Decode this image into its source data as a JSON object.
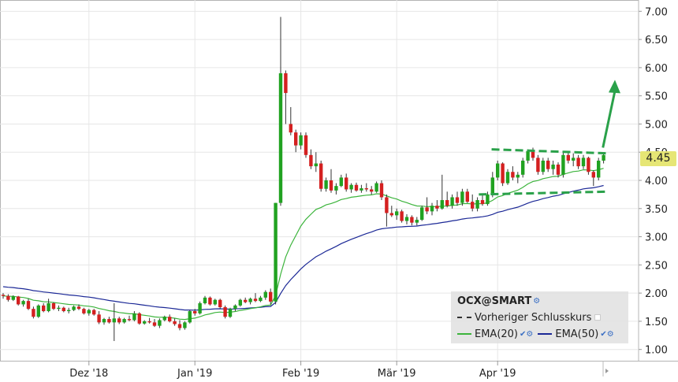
{
  "chart_data": {
    "type": "candlestick",
    "y_ticks": [
      "7.00",
      "6.50",
      "6.00",
      "5.50",
      "5.00",
      "4.50",
      "4.00",
      "3.50",
      "3.00",
      "2.50",
      "2.00",
      "1.50",
      "1.00"
    ],
    "ylim": [
      0.8,
      7.2
    ],
    "x_ticks": [
      "Dez '18",
      "Jan '19",
      "Feb '19",
      "Mär '19",
      "Apr '19"
    ],
    "x_tick_index": [
      17,
      38,
      59,
      78,
      98
    ],
    "current_price": "4.45",
    "candles": [
      [
        1.97,
        2.0,
        1.9,
        1.95
      ],
      [
        1.95,
        1.98,
        1.85,
        1.88
      ],
      [
        1.88,
        1.96,
        1.86,
        1.94
      ],
      [
        1.94,
        1.95,
        1.78,
        1.8
      ],
      [
        1.8,
        1.88,
        1.76,
        1.86
      ],
      [
        1.86,
        1.9,
        1.7,
        1.72
      ],
      [
        1.72,
        1.76,
        1.55,
        1.58
      ],
      [
        1.58,
        1.8,
        1.56,
        1.78
      ],
      [
        1.78,
        1.82,
        1.66,
        1.68
      ],
      [
        1.68,
        1.9,
        1.66,
        1.82
      ],
      [
        1.82,
        1.84,
        1.7,
        1.72
      ],
      [
        1.72,
        1.78,
        1.68,
        1.74
      ],
      [
        1.74,
        1.76,
        1.66,
        1.68
      ],
      [
        1.68,
        1.74,
        1.64,
        1.7
      ],
      [
        1.7,
        1.78,
        1.68,
        1.76
      ],
      [
        1.76,
        1.8,
        1.7,
        1.72
      ],
      [
        1.72,
        1.74,
        1.62,
        1.64
      ],
      [
        1.64,
        1.72,
        1.6,
        1.7
      ],
      [
        1.7,
        1.72,
        1.6,
        1.62
      ],
      [
        1.62,
        1.68,
        1.45,
        1.48
      ],
      [
        1.48,
        1.56,
        1.44,
        1.54
      ],
      [
        1.54,
        1.58,
        1.46,
        1.48
      ],
      [
        1.48,
        1.82,
        1.15,
        1.55
      ],
      [
        1.55,
        1.58,
        1.45,
        1.48
      ],
      [
        1.48,
        1.56,
        1.46,
        1.54
      ],
      [
        1.54,
        1.6,
        1.5,
        1.52
      ],
      [
        1.52,
        1.68,
        1.5,
        1.64
      ],
      [
        1.64,
        1.66,
        1.44,
        1.46
      ],
      [
        1.46,
        1.52,
        1.44,
        1.5
      ],
      [
        1.5,
        1.56,
        1.46,
        1.48
      ],
      [
        1.48,
        1.54,
        1.4,
        1.42
      ],
      [
        1.42,
        1.55,
        1.38,
        1.52
      ],
      [
        1.52,
        1.6,
        1.5,
        1.58
      ],
      [
        1.58,
        1.62,
        1.48,
        1.5
      ],
      [
        1.5,
        1.55,
        1.42,
        1.45
      ],
      [
        1.45,
        1.52,
        1.34,
        1.38
      ],
      [
        1.38,
        1.5,
        1.35,
        1.48
      ],
      [
        1.48,
        1.7,
        1.46,
        1.68
      ],
      [
        1.68,
        1.72,
        1.6,
        1.64
      ],
      [
        1.64,
        1.85,
        1.62,
        1.82
      ],
      [
        1.82,
        1.95,
        1.8,
        1.92
      ],
      [
        1.92,
        1.94,
        1.78,
        1.8
      ],
      [
        1.8,
        1.9,
        1.78,
        1.88
      ],
      [
        1.88,
        1.9,
        1.72,
        1.75
      ],
      [
        1.75,
        1.78,
        1.55,
        1.58
      ],
      [
        1.58,
        1.74,
        1.56,
        1.72
      ],
      [
        1.72,
        1.8,
        1.68,
        1.78
      ],
      [
        1.78,
        1.9,
        1.76,
        1.88
      ],
      [
        1.88,
        1.92,
        1.82,
        1.84
      ],
      [
        1.84,
        1.92,
        1.8,
        1.9
      ],
      [
        1.9,
        2.0,
        1.84,
        1.86
      ],
      [
        1.86,
        1.95,
        1.84,
        1.92
      ],
      [
        1.92,
        2.05,
        1.88,
        2.02
      ],
      [
        2.02,
        2.08,
        1.8,
        1.85
      ],
      [
        1.85,
        3.6,
        1.8,
        3.6
      ],
      [
        3.6,
        6.9,
        3.55,
        5.9
      ],
      [
        5.9,
        5.95,
        5.0,
        5.55
      ],
      [
        5.0,
        5.3,
        4.8,
        4.85
      ],
      [
        4.85,
        4.9,
        4.5,
        4.62
      ],
      [
        4.62,
        4.85,
        4.55,
        4.8
      ],
      [
        4.8,
        4.85,
        4.4,
        4.45
      ],
      [
        4.45,
        4.55,
        4.2,
        4.25
      ],
      [
        4.25,
        4.5,
        4.15,
        4.3
      ],
      [
        4.3,
        4.35,
        3.8,
        3.85
      ],
      [
        3.85,
        4.05,
        3.8,
        4.0
      ],
      [
        4.0,
        4.2,
        3.78,
        3.82
      ],
      [
        3.82,
        3.95,
        3.75,
        3.9
      ],
      [
        3.9,
        4.1,
        3.88,
        4.05
      ],
      [
        4.05,
        4.12,
        3.8,
        3.84
      ],
      [
        3.84,
        3.95,
        3.78,
        3.92
      ],
      [
        3.92,
        3.96,
        3.8,
        3.82
      ],
      [
        3.82,
        3.92,
        3.78,
        3.86
      ],
      [
        3.86,
        3.95,
        3.8,
        3.84
      ],
      [
        3.84,
        3.9,
        3.75,
        3.8
      ],
      [
        3.8,
        3.98,
        3.78,
        3.95
      ],
      [
        3.95,
        4.0,
        3.65,
        3.7
      ],
      [
        3.7,
        3.75,
        3.18,
        3.42
      ],
      [
        3.42,
        3.55,
        3.35,
        3.38
      ],
      [
        3.38,
        3.5,
        3.3,
        3.45
      ],
      [
        3.45,
        3.48,
        3.25,
        3.28
      ],
      [
        3.28,
        3.4,
        3.22,
        3.35
      ],
      [
        3.35,
        3.38,
        3.2,
        3.25
      ],
      [
        3.25,
        3.35,
        3.2,
        3.3
      ],
      [
        3.3,
        3.55,
        3.28,
        3.52
      ],
      [
        3.52,
        3.7,
        3.4,
        3.45
      ],
      [
        3.45,
        3.6,
        3.38,
        3.55
      ],
      [
        3.55,
        3.65,
        3.45,
        3.5
      ],
      [
        3.5,
        4.1,
        3.48,
        3.65
      ],
      [
        3.65,
        3.8,
        3.52,
        3.55
      ],
      [
        3.55,
        3.75,
        3.5,
        3.7
      ],
      [
        3.7,
        3.8,
        3.55,
        3.6
      ],
      [
        3.6,
        3.85,
        3.55,
        3.8
      ],
      [
        3.8,
        3.85,
        3.6,
        3.62
      ],
      [
        3.62,
        3.75,
        3.45,
        3.5
      ],
      [
        3.5,
        3.7,
        3.45,
        3.65
      ],
      [
        3.65,
        3.75,
        3.55,
        3.58
      ],
      [
        3.58,
        3.8,
        3.55,
        3.75
      ],
      [
        3.75,
        4.15,
        3.7,
        4.05
      ],
      [
        4.05,
        4.35,
        4.0,
        4.3
      ],
      [
        4.3,
        4.32,
        3.9,
        3.95
      ],
      [
        3.95,
        4.2,
        3.92,
        4.15
      ],
      [
        4.15,
        4.25,
        4.0,
        4.05
      ],
      [
        4.05,
        4.15,
        3.95,
        4.1
      ],
      [
        4.1,
        4.4,
        4.05,
        4.35
      ],
      [
        4.35,
        4.55,
        4.3,
        4.52
      ],
      [
        4.52,
        4.58,
        4.35,
        4.4
      ],
      [
        4.4,
        4.45,
        4.1,
        4.15
      ],
      [
        4.15,
        4.4,
        4.1,
        4.35
      ],
      [
        4.35,
        4.4,
        4.15,
        4.2
      ],
      [
        4.2,
        4.35,
        4.1,
        4.28
      ],
      [
        4.28,
        4.32,
        4.05,
        4.1
      ],
      [
        4.1,
        4.5,
        4.05,
        4.45
      ],
      [
        4.45,
        4.5,
        4.3,
        4.35
      ],
      [
        4.35,
        4.48,
        4.25,
        4.4
      ],
      [
        4.4,
        4.45,
        4.2,
        4.25
      ],
      [
        4.25,
        4.45,
        4.2,
        4.4
      ],
      [
        4.4,
        4.42,
        4.1,
        4.15
      ],
      [
        4.15,
        4.18,
        3.9,
        4.05
      ],
      [
        4.05,
        4.4,
        4.0,
        4.35
      ],
      [
        4.35,
        4.48,
        4.3,
        4.45
      ]
    ],
    "ema20_start": 1.95,
    "ema50_start": 2.12,
    "annotations": {
      "resistance": [
        [
          0.955,
          4.55
        ],
        [
          1.0,
          4.48
        ]
      ],
      "support": [
        [
          0.935,
          3.75
        ],
        [
          1.0,
          3.8
        ]
      ],
      "arrow": [
        [
          0.975,
          4.65
        ],
        [
          1.0,
          5.7
        ]
      ]
    }
  },
  "legend": {
    "title": "OCX@SMART",
    "prev_close": "Vorheriger Schlusskurs",
    "ema20": "EMA(20)",
    "ema50": "EMA(50)"
  },
  "colors": {
    "up": "#21a221",
    "down": "#d42020",
    "ema20": "#3cb43c",
    "ema50": "#1b2896",
    "annotation": "#2aa14a",
    "badge": "#e6e675"
  }
}
